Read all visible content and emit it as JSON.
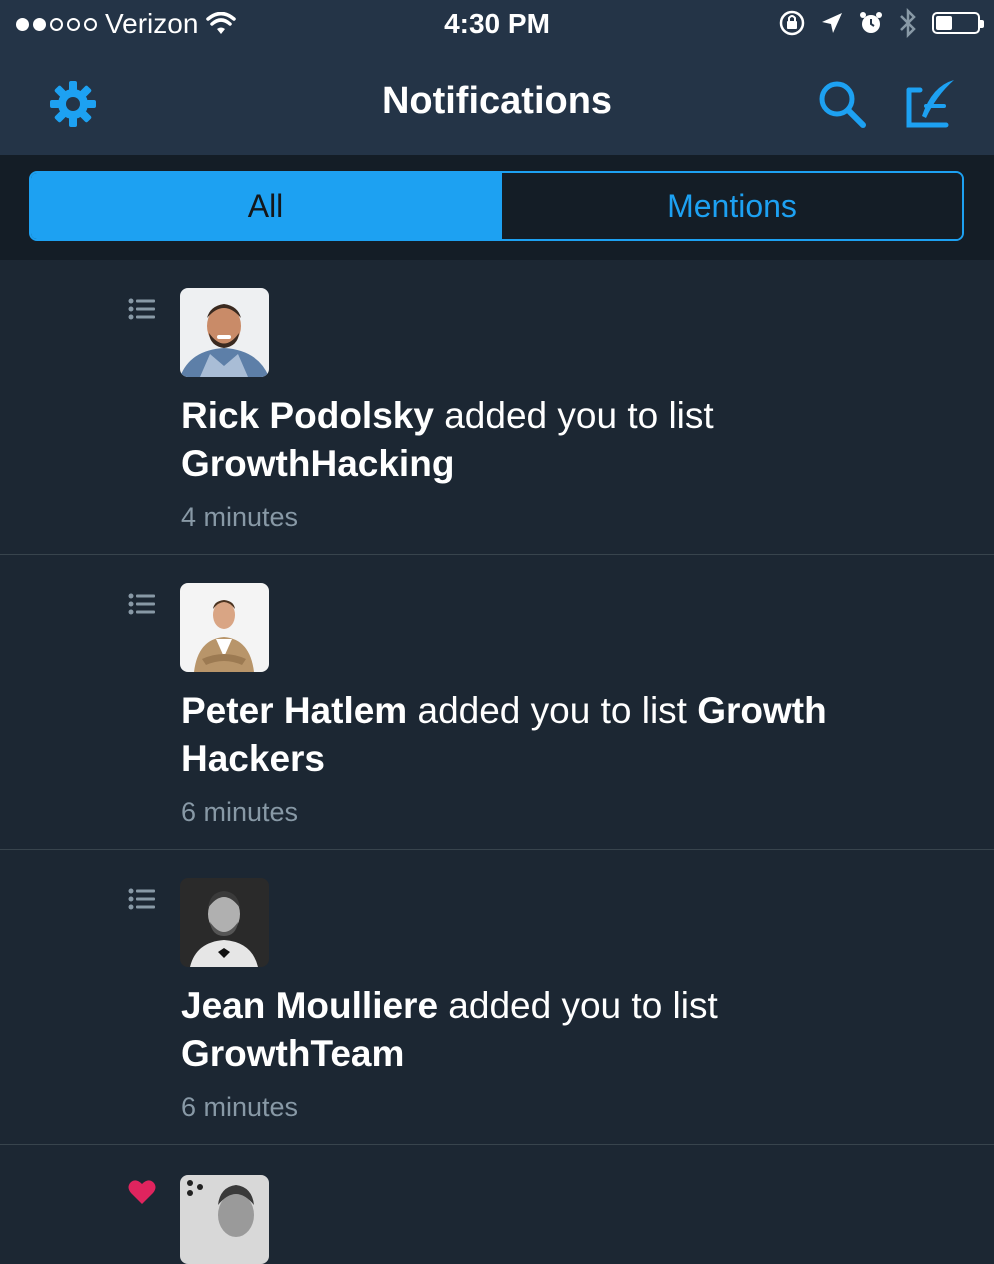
{
  "status_bar": {
    "carrier": "Verizon",
    "time": "4:30 PM",
    "signal_strength": 2,
    "signal_max": 5,
    "battery_level": 0.4
  },
  "nav": {
    "title": "Notifications",
    "left_icon": "gear-icon",
    "right_icons": [
      "search-icon",
      "compose-icon"
    ]
  },
  "tabs": {
    "all_label": "All",
    "mentions_label": "Mentions",
    "selected": "All"
  },
  "notifications": [
    {
      "type": "list-add",
      "icon": "list-icon",
      "user": "Rick Podolsky",
      "action": " added you to list ",
      "list_name": "GrowthHacking",
      "time": "4 minutes"
    },
    {
      "type": "list-add",
      "icon": "list-icon",
      "user": "Peter Hatlem",
      "action": " added you to list ",
      "list_name": "Growth Hackers",
      "time": "6 minutes"
    },
    {
      "type": "list-add",
      "icon": "list-icon",
      "user": "Jean Moulliere",
      "action": " added you to list ",
      "list_name": "GrowthTeam",
      "time": "6 minutes"
    },
    {
      "type": "like",
      "icon": "heart-icon"
    }
  ],
  "colors": {
    "accent": "#1da1f2",
    "background": "#1c2733",
    "bar": "#243447",
    "secondary_text": "#8899a6",
    "like": "#e0245e"
  }
}
